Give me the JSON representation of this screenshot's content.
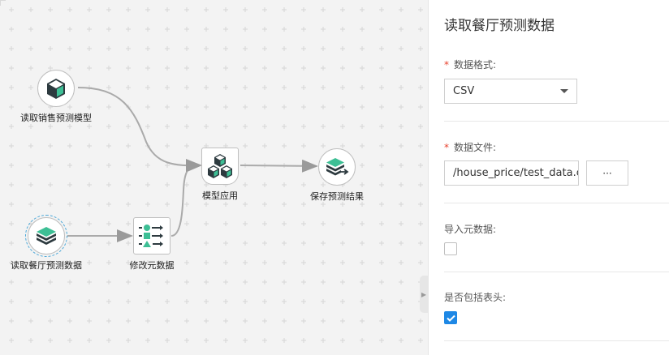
{
  "canvas": {
    "nodes": [
      {
        "id": "model",
        "label": "读取销售预测模型",
        "icon": "cube-icon"
      },
      {
        "id": "read-data",
        "label": "读取餐厅预测数据",
        "icon": "layers-icon",
        "selected": true
      },
      {
        "id": "modify",
        "label": "修改元数据",
        "icon": "metadata-icon"
      },
      {
        "id": "apply",
        "label": "模型应用",
        "icon": "cubes-icon"
      },
      {
        "id": "save",
        "label": "保存预测结果",
        "icon": "layers-export-icon"
      }
    ],
    "colors": {
      "accent": "#3dbf95",
      "dark": "#2d3a3f"
    }
  },
  "panel": {
    "title": "读取餐厅预测数据",
    "format": {
      "label": "数据格式:",
      "value": "CSV"
    },
    "file": {
      "label": "数据文件:",
      "value": "/house_price/test_data.csv",
      "browse": "···"
    },
    "import_meta": {
      "label": "导入元数据:",
      "checked": false
    },
    "header": {
      "label": "是否包括表头:",
      "checked": true
    }
  }
}
